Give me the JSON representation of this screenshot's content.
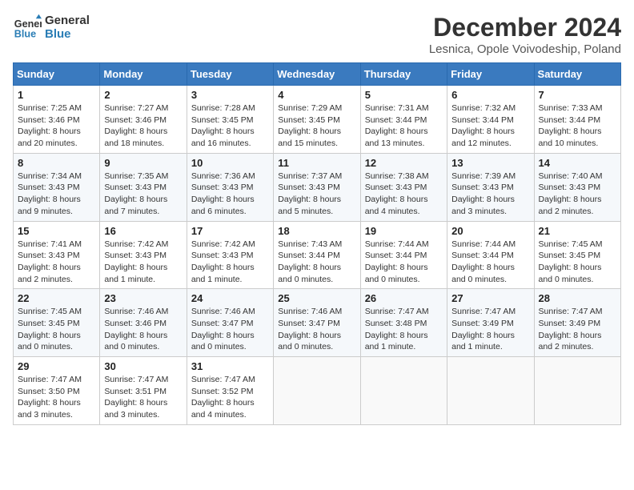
{
  "header": {
    "logo_line1": "General",
    "logo_line2": "Blue",
    "title": "December 2024",
    "subtitle": "Lesnica, Opole Voivodeship, Poland"
  },
  "weekdays": [
    "Sunday",
    "Monday",
    "Tuesday",
    "Wednesday",
    "Thursday",
    "Friday",
    "Saturday"
  ],
  "weeks": [
    [
      {
        "day": "1",
        "sunrise": "7:25 AM",
        "sunset": "3:46 PM",
        "daylight": "8 hours and 20 minutes."
      },
      {
        "day": "2",
        "sunrise": "7:27 AM",
        "sunset": "3:46 PM",
        "daylight": "8 hours and 18 minutes."
      },
      {
        "day": "3",
        "sunrise": "7:28 AM",
        "sunset": "3:45 PM",
        "daylight": "8 hours and 16 minutes."
      },
      {
        "day": "4",
        "sunrise": "7:29 AM",
        "sunset": "3:45 PM",
        "daylight": "8 hours and 15 minutes."
      },
      {
        "day": "5",
        "sunrise": "7:31 AM",
        "sunset": "3:44 PM",
        "daylight": "8 hours and 13 minutes."
      },
      {
        "day": "6",
        "sunrise": "7:32 AM",
        "sunset": "3:44 PM",
        "daylight": "8 hours and 12 minutes."
      },
      {
        "day": "7",
        "sunrise": "7:33 AM",
        "sunset": "3:44 PM",
        "daylight": "8 hours and 10 minutes."
      }
    ],
    [
      {
        "day": "8",
        "sunrise": "7:34 AM",
        "sunset": "3:43 PM",
        "daylight": "8 hours and 9 minutes."
      },
      {
        "day": "9",
        "sunrise": "7:35 AM",
        "sunset": "3:43 PM",
        "daylight": "8 hours and 7 minutes."
      },
      {
        "day": "10",
        "sunrise": "7:36 AM",
        "sunset": "3:43 PM",
        "daylight": "8 hours and 6 minutes."
      },
      {
        "day": "11",
        "sunrise": "7:37 AM",
        "sunset": "3:43 PM",
        "daylight": "8 hours and 5 minutes."
      },
      {
        "day": "12",
        "sunrise": "7:38 AM",
        "sunset": "3:43 PM",
        "daylight": "8 hours and 4 minutes."
      },
      {
        "day": "13",
        "sunrise": "7:39 AM",
        "sunset": "3:43 PM",
        "daylight": "8 hours and 3 minutes."
      },
      {
        "day": "14",
        "sunrise": "7:40 AM",
        "sunset": "3:43 PM",
        "daylight": "8 hours and 2 minutes."
      }
    ],
    [
      {
        "day": "15",
        "sunrise": "7:41 AM",
        "sunset": "3:43 PM",
        "daylight": "8 hours and 2 minutes."
      },
      {
        "day": "16",
        "sunrise": "7:42 AM",
        "sunset": "3:43 PM",
        "daylight": "8 hours and 1 minute."
      },
      {
        "day": "17",
        "sunrise": "7:42 AM",
        "sunset": "3:43 PM",
        "daylight": "8 hours and 1 minute."
      },
      {
        "day": "18",
        "sunrise": "7:43 AM",
        "sunset": "3:44 PM",
        "daylight": "8 hours and 0 minutes."
      },
      {
        "day": "19",
        "sunrise": "7:44 AM",
        "sunset": "3:44 PM",
        "daylight": "8 hours and 0 minutes."
      },
      {
        "day": "20",
        "sunrise": "7:44 AM",
        "sunset": "3:44 PM",
        "daylight": "8 hours and 0 minutes."
      },
      {
        "day": "21",
        "sunrise": "7:45 AM",
        "sunset": "3:45 PM",
        "daylight": "8 hours and 0 minutes."
      }
    ],
    [
      {
        "day": "22",
        "sunrise": "7:45 AM",
        "sunset": "3:45 PM",
        "daylight": "8 hours and 0 minutes."
      },
      {
        "day": "23",
        "sunrise": "7:46 AM",
        "sunset": "3:46 PM",
        "daylight": "8 hours and 0 minutes."
      },
      {
        "day": "24",
        "sunrise": "7:46 AM",
        "sunset": "3:47 PM",
        "daylight": "8 hours and 0 minutes."
      },
      {
        "day": "25",
        "sunrise": "7:46 AM",
        "sunset": "3:47 PM",
        "daylight": "8 hours and 0 minutes."
      },
      {
        "day": "26",
        "sunrise": "7:47 AM",
        "sunset": "3:48 PM",
        "daylight": "8 hours and 1 minute."
      },
      {
        "day": "27",
        "sunrise": "7:47 AM",
        "sunset": "3:49 PM",
        "daylight": "8 hours and 1 minute."
      },
      {
        "day": "28",
        "sunrise": "7:47 AM",
        "sunset": "3:49 PM",
        "daylight": "8 hours and 2 minutes."
      }
    ],
    [
      {
        "day": "29",
        "sunrise": "7:47 AM",
        "sunset": "3:50 PM",
        "daylight": "8 hours and 3 minutes."
      },
      {
        "day": "30",
        "sunrise": "7:47 AM",
        "sunset": "3:51 PM",
        "daylight": "8 hours and 3 minutes."
      },
      {
        "day": "31",
        "sunrise": "7:47 AM",
        "sunset": "3:52 PM",
        "daylight": "8 hours and 4 minutes."
      },
      null,
      null,
      null,
      null
    ]
  ]
}
